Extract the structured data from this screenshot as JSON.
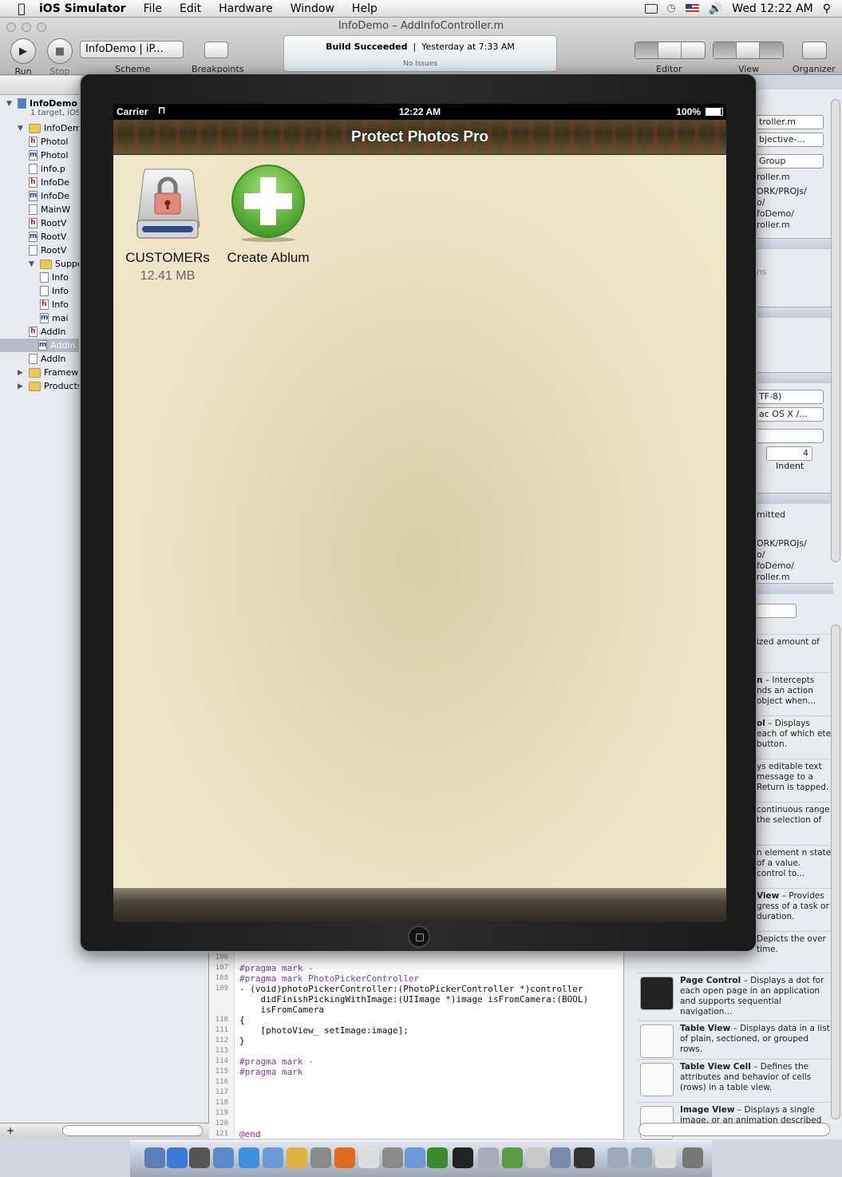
{
  "menubar": {
    "app_name": "iOS Simulator",
    "items": [
      "File",
      "Edit",
      "Hardware",
      "Window",
      "Help"
    ],
    "clock": "Wed 12:22 AM"
  },
  "xcode": {
    "window_title": "InfoDemo – AddInfoController.m",
    "run_label": "Run",
    "stop_label": "Stop",
    "scheme_value": "InfoDemo | iP...",
    "scheme_label": "Scheme",
    "breakpoints_label": "Breakpoints",
    "activity": {
      "status": "Build Succeeded",
      "time": "Yesterday at 7:33 AM",
      "issues": "No Issues"
    },
    "editor_label": "Editor",
    "view_label": "View",
    "organizer_label": "Organizer"
  },
  "navigator": {
    "project": "InfoDemo",
    "project_sub": "1 target, iOS",
    "rows": [
      {
        "type": "folder",
        "label": "InfoDem"
      },
      {
        "type": "h",
        "label": "Photol"
      },
      {
        "type": "m",
        "label": "Photol"
      },
      {
        "type": "plist",
        "label": "info.p"
      },
      {
        "type": "h",
        "label": "InfoDe"
      },
      {
        "type": "m",
        "label": "InfoDe"
      },
      {
        "type": "xib",
        "label": "MainW"
      },
      {
        "type": "h",
        "label": "RootV"
      },
      {
        "type": "m",
        "label": "RootV"
      },
      {
        "type": "xib",
        "label": "RootV"
      },
      {
        "type": "folder",
        "label": "Suppo"
      },
      {
        "type": "plist",
        "label": "Info"
      },
      {
        "type": "file",
        "label": "Info"
      },
      {
        "type": "h",
        "label": "Info"
      },
      {
        "type": "m",
        "label": "mai"
      },
      {
        "type": "h",
        "label": "AddIn"
      },
      {
        "type": "m",
        "label": "AddIn"
      },
      {
        "type": "xib",
        "label": "AddIn"
      },
      {
        "type": "folder",
        "label": "Framewo"
      },
      {
        "type": "folder",
        "label": "Products"
      }
    ]
  },
  "editor": {
    "lines": [
      {
        "n": "106",
        "t": ""
      },
      {
        "n": "107",
        "t": "#pragma mark -"
      },
      {
        "n": "108",
        "t": "#pragma mark PhotoPickerController"
      },
      {
        "n": "109",
        "t": "- (void)photoPickerController:(PhotoPickerController *)controller"
      },
      {
        "n": "",
        "t": "    didFinishPickingWithImage:(UIImage *)image isFromCamera:(BOOL)"
      },
      {
        "n": "",
        "t": "    isFromCamera"
      },
      {
        "n": "110",
        "t": "{"
      },
      {
        "n": "111",
        "t": "    [photoView_ setImage:image];"
      },
      {
        "n": "112",
        "t": "}"
      },
      {
        "n": "113",
        "t": ""
      },
      {
        "n": "114",
        "t": "#pragma mark -"
      },
      {
        "n": "115",
        "t": "#pragma mark"
      },
      {
        "n": "116",
        "t": ""
      },
      {
        "n": "117",
        "t": ""
      },
      {
        "n": "118",
        "t": ""
      },
      {
        "n": "119",
        "t": ""
      },
      {
        "n": "120",
        "t": ""
      },
      {
        "n": "121",
        "t": "@end"
      }
    ]
  },
  "inspector": {
    "file_name": "troller.m",
    "file_type": "bjective-...",
    "location": "Group",
    "path_name": "roller.m",
    "full_path": [
      "ORK/PROJs/",
      "o/",
      "foDemo/",
      "roller.m"
    ],
    "ns": "ns",
    "encoding": "TF-8)",
    "line_endings": "ac OS X /...",
    "indent_value": "4",
    "indent_label": "Indent",
    "scm": "mitted",
    "scm_path": [
      "ORK/PROJs/",
      "o/",
      "foDemo/",
      "roller.m"
    ],
    "library": [
      {
        "text": "ized amount of"
      },
      {
        "bold": "n",
        "text": " – Intercepts nds an action object when..."
      },
      {
        "bold": "ol",
        "text": " – Displays each of which ete button."
      },
      {
        "bold": "",
        "text": "ys editable text message to a Return is tapped."
      },
      {
        "bold": "",
        "text": "continuous range the selection of"
      },
      {
        "bold": "",
        "text": "n element n state of a value. control to..."
      },
      {
        "bold": "View",
        "text": " – Provides gress of a task or duration."
      },
      {
        "bold": "",
        "text": "Depicts the over time."
      },
      {
        "bold": "Page Control",
        "text": " – Displays a dot for each open page in an application and supports sequential navigation..."
      },
      {
        "bold": "Table View",
        "text": " – Displays data in a list of plain, sectioned, or grouped rows."
      },
      {
        "bold": "Table View Cell",
        "text": " – Defines the attributes and behavior of cells (rows) in a table view."
      },
      {
        "bold": "Image View",
        "text": " – Displays a single image, or an animation described by"
      }
    ]
  },
  "simulator": {
    "carrier": "Carrier",
    "time": "12:22 AM",
    "battery": "100%",
    "title": "Protect Photos Pro",
    "items": [
      {
        "label": "CUSTOMERs",
        "size": "12.41 MB",
        "icon": "locked-drive-icon"
      },
      {
        "label": "Create Ablum",
        "icon": "add-plus-icon"
      }
    ]
  },
  "colors": {
    "accent_green": "#4aa72a",
    "paper": "#ece3c4"
  }
}
